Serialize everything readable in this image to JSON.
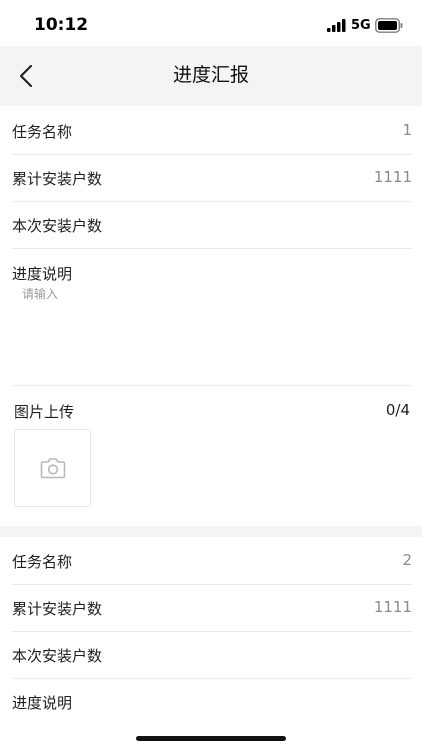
{
  "status_bar": {
    "time": "10:12",
    "network": "5G"
  },
  "header": {
    "title": "进度汇报"
  },
  "sections": [
    {
      "task_name": {
        "label": "任务名称",
        "value": "1"
      },
      "total_installs": {
        "label": "累计安装户数",
        "value": "1111"
      },
      "current_installs": {
        "label": "本次安装户数",
        "value": ""
      },
      "progress_note": {
        "label": "进度说明",
        "placeholder": "请输入"
      },
      "image_upload": {
        "label": "图片上传",
        "count": "0/4"
      }
    },
    {
      "task_name": {
        "label": "任务名称",
        "value": "2"
      },
      "total_installs": {
        "label": "累计安装户数",
        "value": "1111"
      },
      "current_installs": {
        "label": "本次安装户数",
        "value": ""
      },
      "progress_note": {
        "label": "进度说明"
      }
    }
  ],
  "icons": {
    "back": "chevron-left-icon",
    "camera": "camera-icon",
    "signal": "signal-icon",
    "battery": "battery-icon"
  },
  "colors": {
    "nav_background": "#f4f4f4",
    "label": "#1f1f1f",
    "value": "#8a8a8a",
    "divider": "#ececec"
  }
}
